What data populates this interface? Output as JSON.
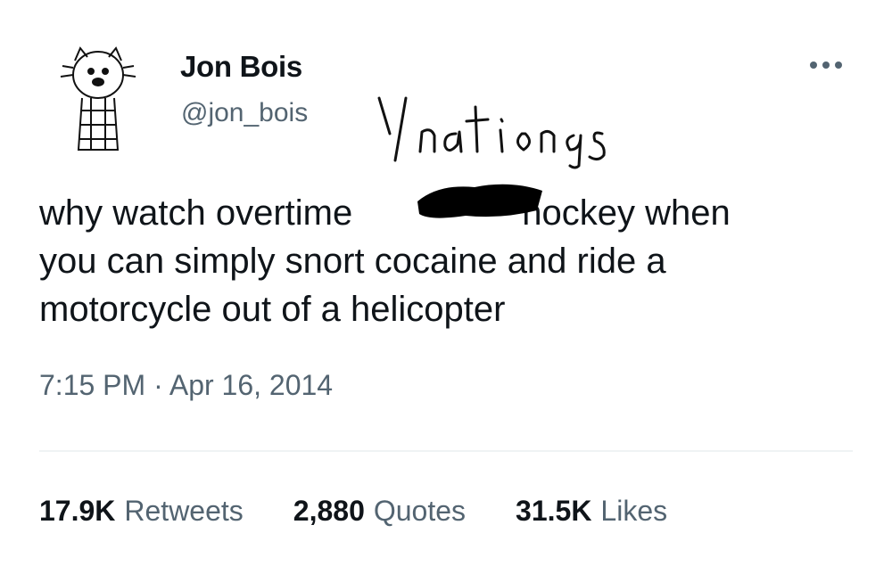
{
  "tweet": {
    "display_name": "Jon Bois",
    "handle": "@jon_bois",
    "text_line1_start": "why watch overtime",
    "text_line1_end": "hockey when",
    "text_line2": "you can simply snort cocaine and ride a",
    "text_line3": "motorcycle out of a helicopter",
    "timestamp": "7:15 PM · Apr 16, 2014",
    "avatar_icon": "calvin-hobbes-avatar-icon",
    "menu_icon": "more-options-icon"
  },
  "handwritten_note": "Ynationos",
  "stats": [
    {
      "count": "17.9K",
      "label": "Retweets"
    },
    {
      "count": "2,880",
      "label": "Quotes"
    },
    {
      "count": "31.5K",
      "label": "Likes"
    }
  ],
  "colors": {
    "text_primary": "#0f1419",
    "text_secondary": "#536471",
    "divider": "#eff3f4",
    "redaction": "#000000"
  }
}
